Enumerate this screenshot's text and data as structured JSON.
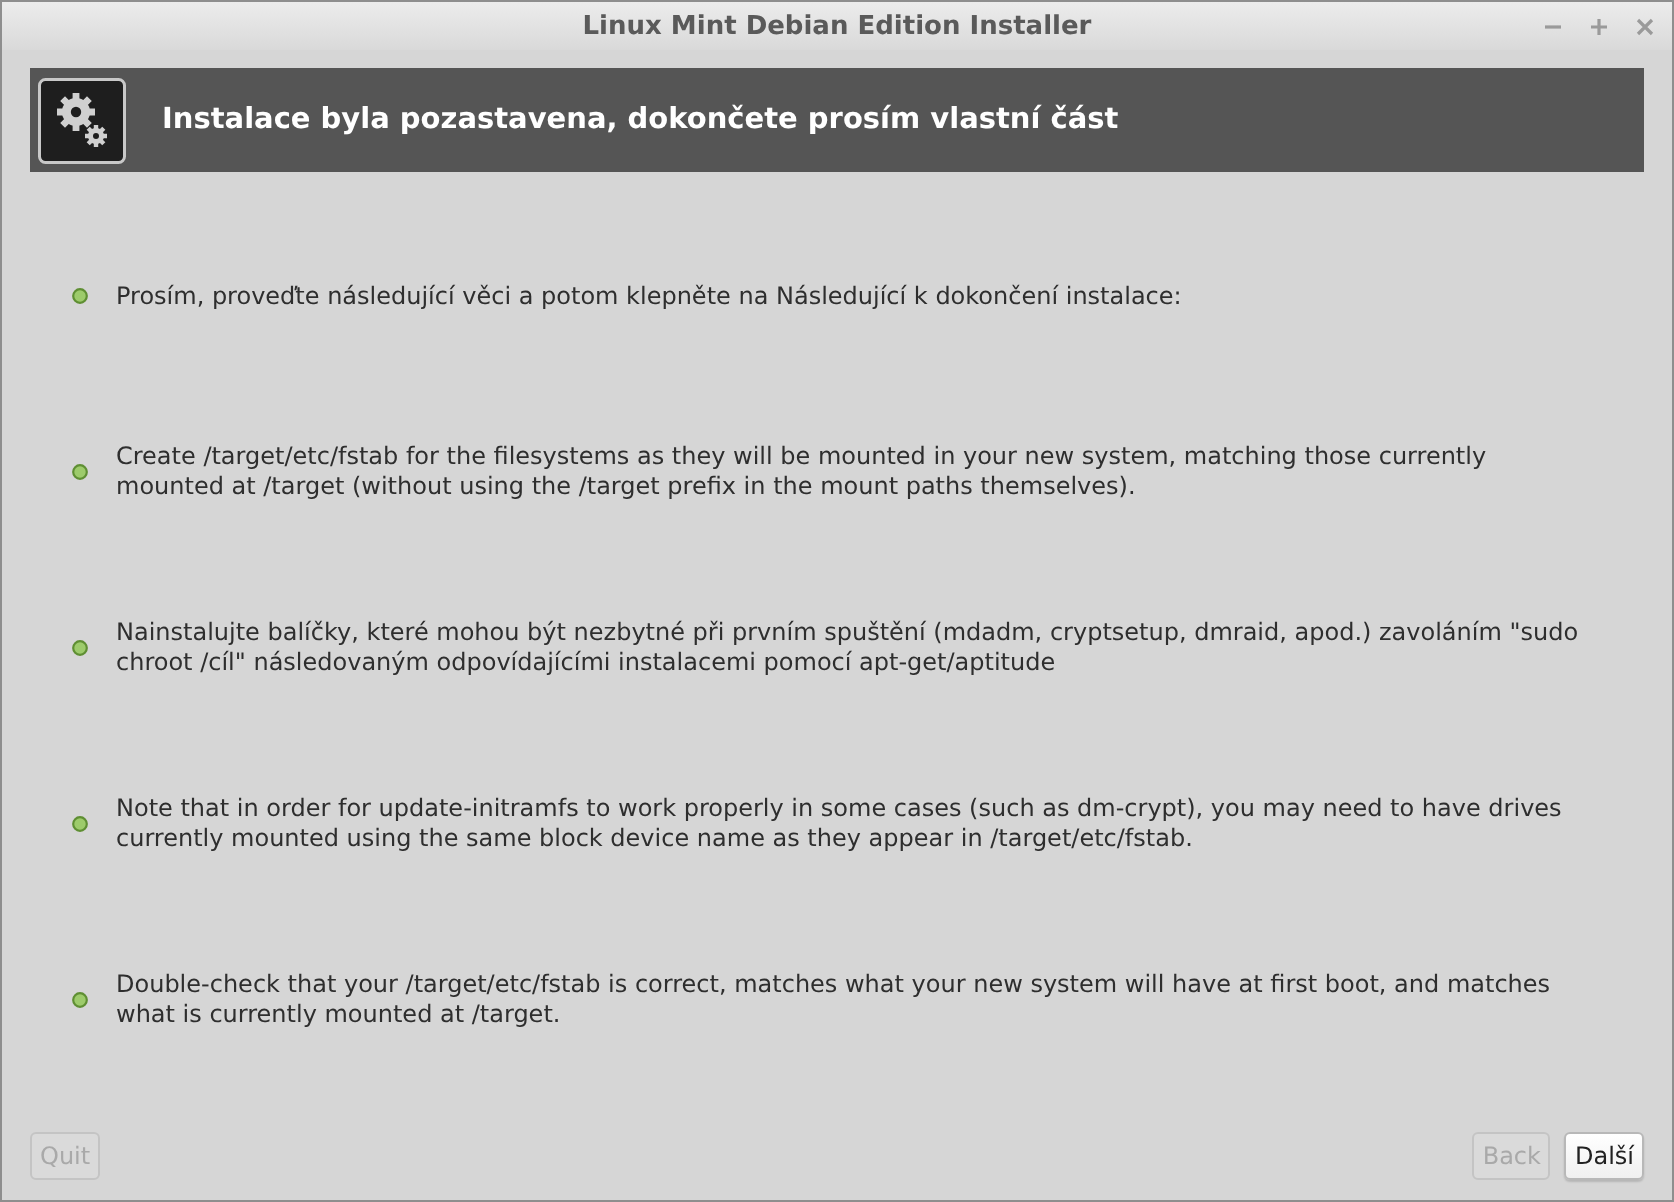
{
  "window": {
    "title": "Linux Mint Debian Edition Installer"
  },
  "header": {
    "title": "Instalace byla pozastavena, dokončete prosím vlastní část"
  },
  "steps": [
    {
      "text": "Prosím, proveďte následující věci a potom klepněte na Následující k dokončení instalace:"
    },
    {
      "text": "Create /target/etc/fstab for the filesystems as they will be mounted in your new system, matching those currently mounted at /target (without using the /target prefix in the mount paths themselves)."
    },
    {
      "text": "Nainstalujte balíčky, které mohou být nezbytné při prvním spuštění (mdadm, cryptsetup, dmraid, apod.) zavoláním \"sudo chroot /cíl\" následovaným odpovídajícími instalacemi pomocí apt-get/aptitude"
    },
    {
      "text": "Note that in order for update-initramfs to work properly in some cases (such as dm-crypt), you may need to have drives currently mounted using the same block device name as they appear in /target/etc/fstab."
    },
    {
      "text": "Double-check that your /target/etc/fstab is correct, matches what your new system will have at first boot, and matches what is currently mounted at /target."
    }
  ],
  "footer": {
    "left_buttons": [
      {
        "label": "Quit",
        "disabled": true
      }
    ],
    "right_buttons": [
      {
        "label": "Back",
        "disabled": true
      },
      {
        "label": "Další",
        "disabled": false
      }
    ]
  }
}
